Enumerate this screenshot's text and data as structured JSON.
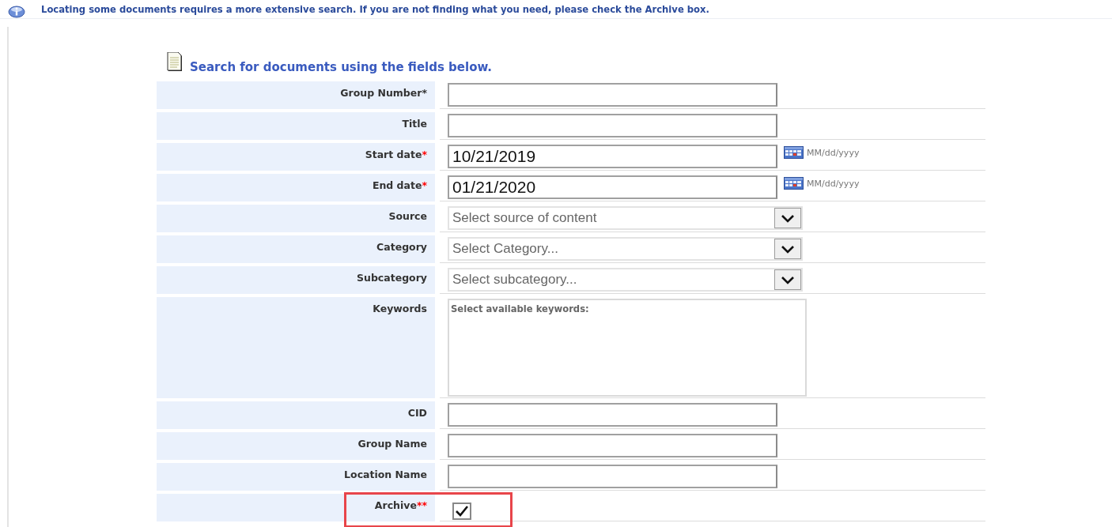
{
  "notice": {
    "text": "Locating some documents requires a more extensive search. If you are not finding what you need, please check the Archive box."
  },
  "heading": "Search for documents using the fields below.",
  "fields": [
    {
      "kind": "text",
      "label": "Group Number",
      "marker": {
        "text": "*",
        "color": "#333333"
      }
    },
    {
      "kind": "text",
      "label": "Title"
    },
    {
      "kind": "date",
      "label": "Start date",
      "marker": {
        "text": "*",
        "color": "#ff0000"
      },
      "value": "10/21/2019",
      "format": "MM/dd/yyyy"
    },
    {
      "kind": "date",
      "label": "End date",
      "marker": {
        "text": "*",
        "color": "#ff0000"
      },
      "value": "01/21/2020",
      "format": "MM/dd/yyyy"
    },
    {
      "kind": "select",
      "label": "Source",
      "placeholder": "Select source of content"
    },
    {
      "kind": "select",
      "label": "Category",
      "placeholder": "Select Category..."
    },
    {
      "kind": "select",
      "label": "Subcategory",
      "placeholder": "Select subcategory..."
    },
    {
      "kind": "keywords",
      "label": "Keywords",
      "caption": "Select available keywords:"
    },
    {
      "kind": "text",
      "label": "CID"
    },
    {
      "kind": "text",
      "label": "Group Name"
    },
    {
      "kind": "text",
      "label": "Location Name"
    },
    {
      "kind": "checkbox",
      "label": "Archive",
      "marker": {
        "text": "**",
        "color": "#ff0000"
      },
      "checked": true,
      "highlighted": true
    }
  ]
}
